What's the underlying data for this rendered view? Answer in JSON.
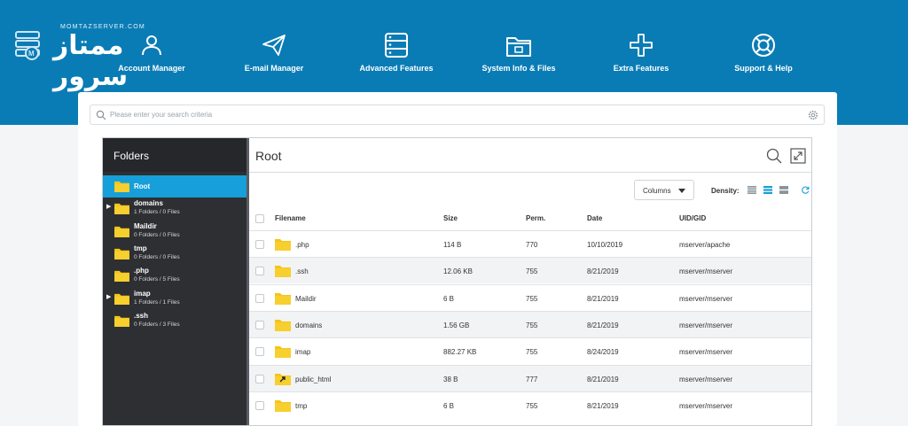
{
  "brand": {
    "subtitle": "MOMTAZSERVER.COM",
    "name": "ممتاز سرور"
  },
  "nav": [
    {
      "label": "Account Manager",
      "icon": "user-group-icon"
    },
    {
      "label": "E-mail Manager",
      "icon": "paper-plane-icon"
    },
    {
      "label": "Advanced Features",
      "icon": "server-icon"
    },
    {
      "label": "System Info & Files",
      "icon": "folder-info-icon"
    },
    {
      "label": "Extra Features",
      "icon": "plus-icon"
    },
    {
      "label": "Support & Help",
      "icon": "lifebuoy-icon"
    }
  ],
  "search": {
    "placeholder": "Please enter your search criteria"
  },
  "sidebar": {
    "title": "Folders",
    "items": [
      {
        "name": "Root",
        "count": "",
        "active": true,
        "expandable": false
      },
      {
        "name": "domains",
        "count": "1 Folders / 0 Files",
        "active": false,
        "expandable": true
      },
      {
        "name": "Maildir",
        "count": "0 Folders / 0 Files",
        "active": false,
        "expandable": false
      },
      {
        "name": "tmp",
        "count": "0 Folders / 0 Files",
        "active": false,
        "expandable": false
      },
      {
        "name": ".php",
        "count": "0 Folders / 5 Files",
        "active": false,
        "expandable": false
      },
      {
        "name": "imap",
        "count": "1 Folders / 1 Files",
        "active": false,
        "expandable": true
      },
      {
        "name": ".ssh",
        "count": "0 Folders / 3 Files",
        "active": false,
        "expandable": false
      }
    ]
  },
  "pane": {
    "title": "Root",
    "columns_button": "Columns",
    "density_label": "Density:",
    "headers": {
      "filename": "Filename",
      "size": "Size",
      "perm": "Perm.",
      "date": "Date",
      "uid": "UID/GID"
    },
    "rows": [
      {
        "name": ".php",
        "size": "114 B",
        "perm": "770",
        "date": "10/10/2019",
        "uid": "mserver/apache",
        "type": "folder"
      },
      {
        "name": ".ssh",
        "size": "12.06 KB",
        "perm": "755",
        "date": "8/21/2019",
        "uid": "mserver/mserver",
        "type": "folder"
      },
      {
        "name": "Maildir",
        "size": "6 B",
        "perm": "755",
        "date": "8/21/2019",
        "uid": "mserver/mserver",
        "type": "folder"
      },
      {
        "name": "domains",
        "size": "1.56 GB",
        "perm": "755",
        "date": "8/21/2019",
        "uid": "mserver/mserver",
        "type": "folder"
      },
      {
        "name": "imap",
        "size": "882.27 KB",
        "perm": "755",
        "date": "8/24/2019",
        "uid": "mserver/mserver",
        "type": "folder"
      },
      {
        "name": "public_html",
        "size": "38 B",
        "perm": "777",
        "date": "8/21/2019",
        "uid": "mserver/mserver",
        "type": "link-folder"
      },
      {
        "name": "tmp",
        "size": "6 B",
        "perm": "755",
        "date": "8/21/2019",
        "uid": "mserver/mserver",
        "type": "folder"
      }
    ]
  },
  "colors": {
    "header_blue": "#0a7cb5",
    "active_blue": "#169fd8",
    "sidebar_dark": "#2d2f33",
    "folder_yellow": "#f5c518"
  }
}
